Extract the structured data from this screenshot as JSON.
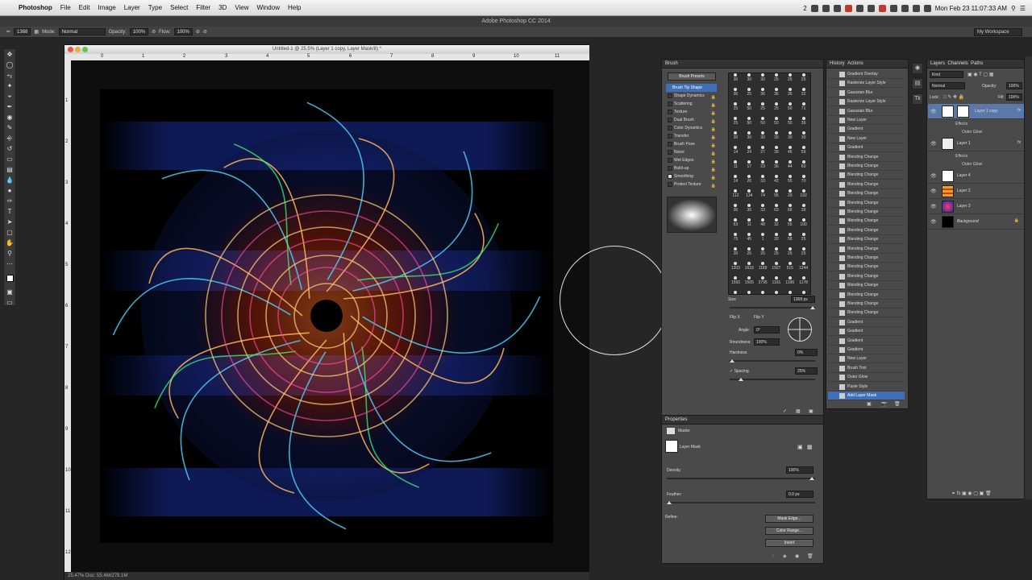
{
  "menubar": {
    "apple": "",
    "app_name": "Photoshop",
    "items": [
      "File",
      "Edit",
      "Image",
      "Layer",
      "Type",
      "Select",
      "Filter",
      "3D",
      "View",
      "Window",
      "Help"
    ],
    "status_number": "2",
    "clock": "Mon Feb 23  11:07:33 AM"
  },
  "app_title": "Adobe Photoshop CC 2014",
  "options": {
    "brush_size": "1368",
    "mode_label": "Mode:",
    "mode_value": "Normal",
    "opacity_label": "Opacity:",
    "opacity_value": "100%",
    "flow_label": "Flow:",
    "flow_value": "100%",
    "workspace": "My Workspace"
  },
  "document": {
    "title": "Untitled-1 @ 25.5% (Layer 1 copy, Layer Mask/8) *",
    "status": "25.47%   Doc: 55.4M/278.1M",
    "ruler_h": [
      "0",
      "1",
      "2",
      "3",
      "4",
      "5",
      "6",
      "7",
      "8",
      "9",
      "10",
      "11",
      "12"
    ],
    "ruler_v": [
      "1",
      "2",
      "3",
      "4",
      "5",
      "6",
      "7",
      "8",
      "9",
      "10",
      "11",
      "12"
    ]
  },
  "brush_panel": {
    "tab": "Brush",
    "presets_button": "Brush Presets",
    "options": [
      {
        "label": "Brush Tip Shape",
        "selected": true,
        "checked": false
      },
      {
        "label": "Shape Dynamics",
        "selected": false,
        "checked": false
      },
      {
        "label": "Scattering",
        "selected": false,
        "checked": false
      },
      {
        "label": "Texture",
        "selected": false,
        "checked": false
      },
      {
        "label": "Dual Brush",
        "selected": false,
        "checked": false
      },
      {
        "label": "Color Dynamics",
        "selected": false,
        "checked": false
      },
      {
        "label": "Transfer",
        "selected": false,
        "checked": false
      },
      {
        "label": "Brush Pose",
        "selected": false,
        "checked": false
      },
      {
        "label": "Noise",
        "selected": false,
        "checked": false
      },
      {
        "label": "Wet Edges",
        "selected": false,
        "checked": false
      },
      {
        "label": "Build-up",
        "selected": false,
        "checked": false
      },
      {
        "label": "Smoothing",
        "selected": false,
        "checked": true
      },
      {
        "label": "Protect Texture",
        "selected": false,
        "checked": false
      }
    ],
    "tip_sizes": [
      "30",
      "30",
      "30",
      "25",
      "25",
      "25",
      "36",
      "25",
      "36",
      "36",
      "36",
      "32",
      "25",
      "50",
      "25",
      "25",
      "50",
      "71",
      "25",
      "50",
      "50",
      "50",
      "50",
      "36",
      "30",
      "30",
      "30",
      "30",
      "30",
      "30",
      "14",
      "24",
      "27",
      "39",
      "46",
      "59",
      "11",
      "17",
      "23",
      "36",
      "44",
      "60",
      "14",
      "26",
      "33",
      "42",
      "55",
      "70",
      "112",
      "134",
      "74",
      "95",
      "29",
      "192",
      "36",
      "36",
      "33",
      "63",
      "66",
      "39",
      "63",
      "11",
      "48",
      "32",
      "55",
      "100",
      "75",
      "45",
      "1",
      "30",
      "58",
      "25",
      "20",
      "25",
      "25",
      "25",
      "25",
      "25",
      "1203",
      "1618",
      "1189",
      "1927",
      "515",
      "1244",
      "1593",
      "1565",
      "3795",
      "1191",
      "1196",
      "1178",
      "1037",
      "1106",
      "1159",
      "1519",
      "453",
      "611",
      "1093",
      "695",
      "1100",
      "1768",
      "1200",
      "1096",
      "1499",
      "2176",
      "843",
      "1432",
      "2171",
      "1058"
    ],
    "size_label": "Size",
    "size_value": "1368 px",
    "flip_x": "Flip X",
    "flip_y": "Flip Y",
    "angle_label": "Angle:",
    "angle_value": "0°",
    "roundness_label": "Roundness:",
    "roundness_value": "100%",
    "hardness_label": "Hardness",
    "hardness_value": "0%",
    "spacing_label": "Spacing",
    "spacing_value": "25%"
  },
  "properties_panel": {
    "tab": "Properties",
    "section": "Masks",
    "mask_label": "Layer Mask",
    "density_label": "Density:",
    "density_value": "100%",
    "feather_label": "Feather:",
    "feather_value": "0.0 px",
    "refine_label": "Refine:",
    "buttons": [
      "Mask Edge...",
      "Color Range...",
      "Invert"
    ]
  },
  "history_panel": {
    "tabs": [
      "History",
      "Actions"
    ],
    "items": [
      "Gradient Overlay",
      "Rasterize Layer Style",
      "Gaussian Blur",
      "Rasterize Layer Style",
      "Gaussian Blur",
      "New Layer",
      "Gradient",
      "New Layer",
      "Gradient",
      "Blending Change",
      "Blending Change",
      "Blending Change",
      "Blending Change",
      "Blending Change",
      "Blending Change",
      "Blending Change",
      "Blending Change",
      "Blending Change",
      "Blending Change",
      "Blending Change",
      "Blending Change",
      "Blending Change",
      "Blending Change",
      "Blending Change",
      "Blending Change",
      "Blending Change",
      "Blending Change",
      "Gradient",
      "Gradient",
      "Gradient",
      "Gradient",
      "New Layer",
      "Brush Tool",
      "Outer Glow",
      "Paste Style",
      "Add Layer Mask"
    ],
    "selected_index": 35
  },
  "layers_panel": {
    "tabs": [
      "Layers",
      "Channels",
      "Paths"
    ],
    "kind": "Kind",
    "blend": "Normal",
    "opacity_label": "Opacity:",
    "opacity_value": "100%",
    "lock_label": "Lock:",
    "fill_label": "Fill:",
    "fill_value": "100%",
    "layers": [
      {
        "name": "Layer 1 copy",
        "selected": true,
        "effects": [
          "Effects",
          "Outer Glow"
        ]
      },
      {
        "name": "Layer 1",
        "selected": false,
        "effects": [
          "Effects",
          "Outer Glow"
        ]
      },
      {
        "name": "Layer 4",
        "selected": false,
        "effects": []
      },
      {
        "name": "Layer 2",
        "selected": false,
        "effects": []
      },
      {
        "name": "Layer 3",
        "selected": false,
        "effects": []
      },
      {
        "name": "Background",
        "selected": false,
        "effects": []
      }
    ]
  },
  "colors": {
    "accent": "#3f6fb5",
    "panel": "#4a4a4a"
  }
}
